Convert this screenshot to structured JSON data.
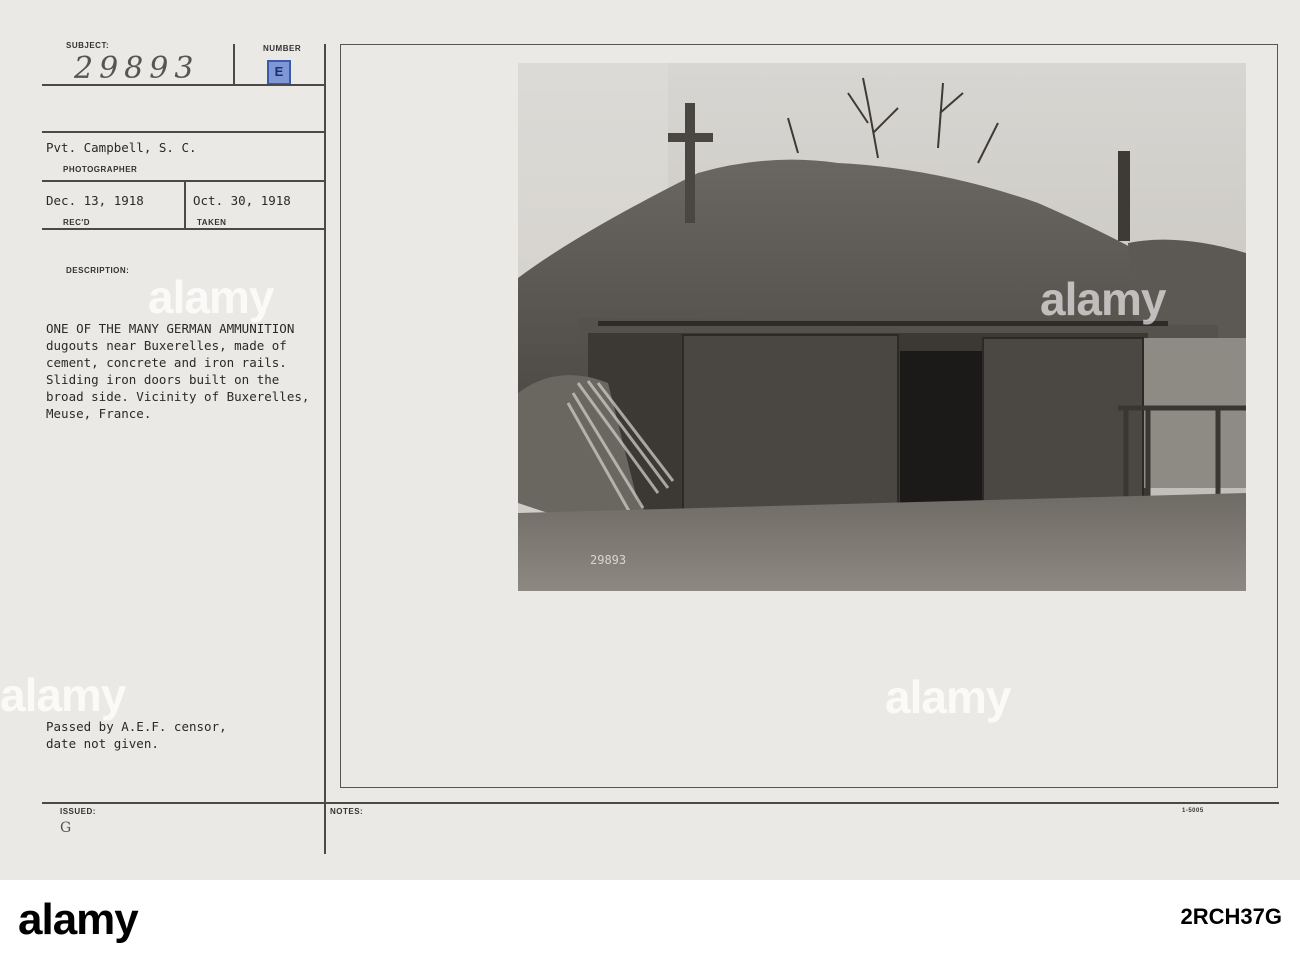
{
  "card": {
    "subject_label": "SUBJECT:",
    "subject_value": "29893",
    "number_label": "NUMBER",
    "number_value": "E",
    "photographer_value": "Pvt. Campbell, S. C.",
    "photographer_label": "PHOTOGRAPHER",
    "recd_value": "Dec. 13, 1918",
    "recd_label": "REC'D",
    "taken_value": "Oct. 30, 1918",
    "taken_label": "TAKEN",
    "description_label": "DESCRIPTION:",
    "description_lines": [
      "ONE OF THE MANY GERMAN AMMUNITION",
      "dugouts near Buxerelles, made of",
      "cement, concrete and iron rails.",
      "Sliding iron doors built on the",
      "broad side. Vicinity of Buxerelles,",
      "Meuse, France."
    ],
    "censor_lines": [
      "Passed by A.E.F. censor,",
      "date not given."
    ],
    "issued_label": "ISSUED:",
    "issued_mark": "G",
    "notes_label": "NOTES:",
    "form_code": "1-5005",
    "photo_number": "29893"
  },
  "watermark": {
    "text": "alamy"
  },
  "footer": {
    "logo": "alamy",
    "image_id": "2RCH37G"
  },
  "colors": {
    "card": "#ebe9e5",
    "stamp": "#7f97d6"
  }
}
